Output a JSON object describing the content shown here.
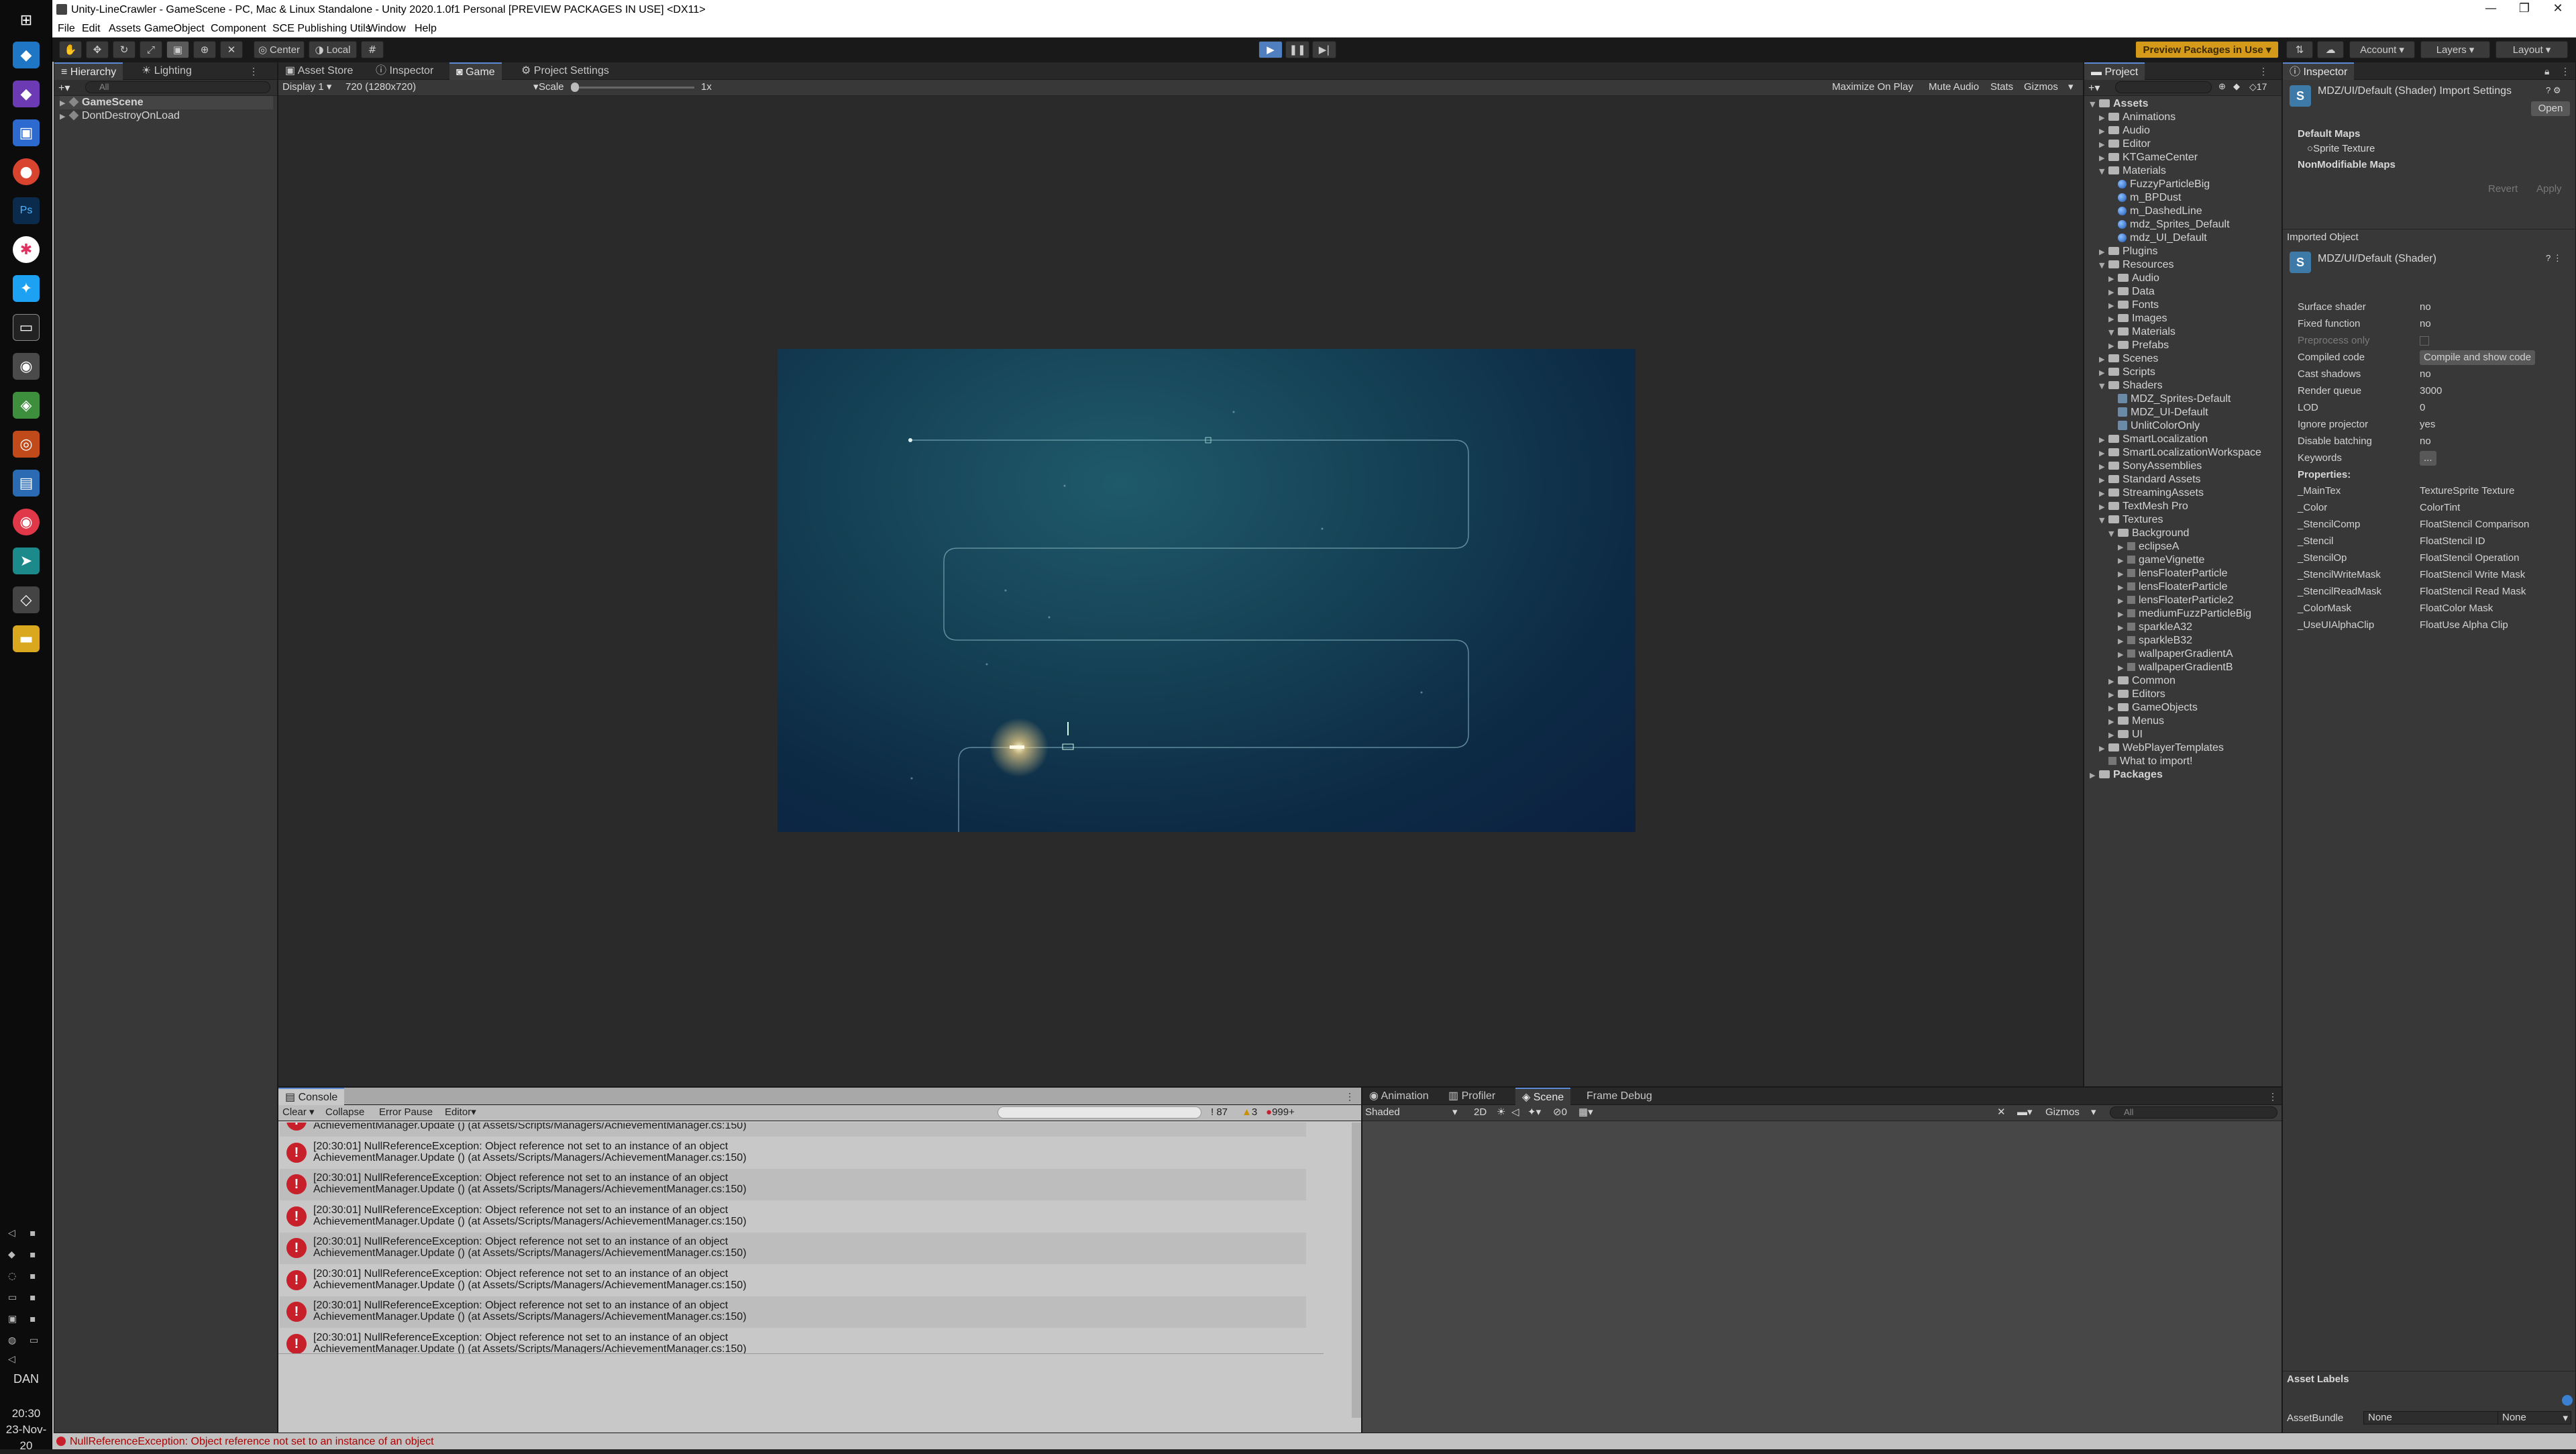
{
  "taskbar": {
    "user": "DAN",
    "time": "20:30",
    "date": "23-Nov-20"
  },
  "window": {
    "title": "Unity-LineCrawler - GameScene - PC, Mac & Linux Standalone - Unity 2020.1.0f1 Personal [PREVIEW PACKAGES IN USE] <DX11>",
    "minimize": "—",
    "restore": "❐",
    "close": "✕"
  },
  "menu": [
    "File",
    "Edit",
    "Assets",
    "GameObject",
    "Component",
    "SCE Publishing Utils",
    "Window",
    "Help"
  ],
  "toolbar": {
    "center": "Center",
    "local": "Local",
    "preview": "Preview Packages in Use ▾",
    "account": "Account",
    "layers": "Layers",
    "layout": "Layout"
  },
  "hierarchy": {
    "tab_hierarchy": "Hierarchy",
    "tab_lighting": "Lighting",
    "search_placeholder": "All",
    "items": [
      "GameScene",
      "DontDestroyOnLoad"
    ]
  },
  "center": {
    "tabs": [
      "Asset Store",
      "Inspector",
      "Game",
      "Project Settings"
    ],
    "display": "Display 1",
    "resolution": "720 (1280x720)",
    "scale_label": "Scale",
    "scale_value": "1x",
    "maximize": "Maximize On Play",
    "mute": "Mute Audio",
    "stats": "Stats",
    "gizmos": "Gizmos"
  },
  "project": {
    "tab": "Project",
    "count": "17",
    "items": [
      {
        "d": 0,
        "t": "Assets",
        "k": "f",
        "b": 1
      },
      {
        "d": 1,
        "t": "Animations",
        "k": "f"
      },
      {
        "d": 1,
        "t": "Audio",
        "k": "f"
      },
      {
        "d": 1,
        "t": "Editor",
        "k": "f"
      },
      {
        "d": 1,
        "t": "KTGameCenter",
        "k": "f"
      },
      {
        "d": 1,
        "t": "Materials",
        "k": "f"
      },
      {
        "d": 2,
        "t": "FuzzyParticleBig",
        "k": "m"
      },
      {
        "d": 2,
        "t": "m_BPDust",
        "k": "m"
      },
      {
        "d": 2,
        "t": "m_DashedLine",
        "k": "m"
      },
      {
        "d": 2,
        "t": "mdz_Sprites_Default",
        "k": "m"
      },
      {
        "d": 2,
        "t": "mdz_UI_Default",
        "k": "m"
      },
      {
        "d": 1,
        "t": "Plugins",
        "k": "f"
      },
      {
        "d": 1,
        "t": "Resources",
        "k": "f"
      },
      {
        "d": 2,
        "t": "Audio",
        "k": "f"
      },
      {
        "d": 2,
        "t": "Data",
        "k": "f"
      },
      {
        "d": 2,
        "t": "Fonts",
        "k": "f"
      },
      {
        "d": 2,
        "t": "Images",
        "k": "f"
      },
      {
        "d": 2,
        "t": "Materials",
        "k": "f"
      },
      {
        "d": 2,
        "t": "Prefabs",
        "k": "f"
      },
      {
        "d": 1,
        "t": "Scenes",
        "k": "f"
      },
      {
        "d": 1,
        "t": "Scripts",
        "k": "f"
      },
      {
        "d": 1,
        "t": "Shaders",
        "k": "f"
      },
      {
        "d": 2,
        "t": "MDZ_Sprites-Default",
        "k": "s"
      },
      {
        "d": 2,
        "t": "MDZ_UI-Default",
        "k": "s"
      },
      {
        "d": 2,
        "t": "UnlitColorOnly",
        "k": "s"
      },
      {
        "d": 1,
        "t": "SmartLocalization",
        "k": "f"
      },
      {
        "d": 1,
        "t": "SmartLocalizationWorkspace",
        "k": "f"
      },
      {
        "d": 1,
        "t": "SonyAssemblies",
        "k": "f"
      },
      {
        "d": 1,
        "t": "Standard Assets",
        "k": "f"
      },
      {
        "d": 1,
        "t": "StreamingAssets",
        "k": "f"
      },
      {
        "d": 1,
        "t": "TextMesh Pro",
        "k": "f"
      },
      {
        "d": 1,
        "t": "Textures",
        "k": "f"
      },
      {
        "d": 2,
        "t": "Background",
        "k": "f"
      },
      {
        "d": 3,
        "t": "eclipseA",
        "k": "t"
      },
      {
        "d": 3,
        "t": "gameVignette",
        "k": "t"
      },
      {
        "d": 3,
        "t": "lensFloaterParticle",
        "k": "t"
      },
      {
        "d": 3,
        "t": "lensFloaterParticle",
        "k": "t"
      },
      {
        "d": 3,
        "t": "lensFloaterParticle2",
        "k": "t"
      },
      {
        "d": 3,
        "t": "mediumFuzzParticleBig",
        "k": "t"
      },
      {
        "d": 3,
        "t": "sparkleA32",
        "k": "t"
      },
      {
        "d": 3,
        "t": "sparkleB32",
        "k": "t"
      },
      {
        "d": 3,
        "t": "wallpaperGradientA",
        "k": "t"
      },
      {
        "d": 3,
        "t": "wallpaperGradientB",
        "k": "t"
      },
      {
        "d": 2,
        "t": "Common",
        "k": "f"
      },
      {
        "d": 2,
        "t": "Editors",
        "k": "f"
      },
      {
        "d": 2,
        "t": "GameObjects",
        "k": "f"
      },
      {
        "d": 2,
        "t": "Menus",
        "k": "f"
      },
      {
        "d": 2,
        "t": "UI",
        "k": "f"
      },
      {
        "d": 1,
        "t": "WebPlayerTemplates",
        "k": "f"
      },
      {
        "d": 1,
        "t": "What to import!",
        "k": "x"
      },
      {
        "d": 0,
        "t": "Packages",
        "k": "f",
        "b": 1
      }
    ]
  },
  "inspector": {
    "tab": "Inspector",
    "title": "MDZ/UI/Default (Shader) Import Settings",
    "open": "Open",
    "default_maps": "Default Maps",
    "sprite_texture": "Sprite Texture",
    "nonmod": "NonModifiable Maps",
    "revert": "Revert",
    "apply": "Apply",
    "imported": "Imported Object",
    "shader_title": "MDZ/UI/Default (Shader)",
    "fields": [
      [
        "Surface shader",
        "no"
      ],
      [
        "Fixed function",
        "no"
      ],
      [
        "Preprocess only",
        ""
      ],
      [
        "Compiled code",
        "Compile and show code"
      ],
      [
        "Cast shadows",
        "no"
      ],
      [
        "Render queue",
        "3000"
      ],
      [
        "LOD",
        "0"
      ],
      [
        "Ignore projector",
        "yes"
      ],
      [
        "Disable batching",
        "no"
      ],
      [
        "Keywords",
        "..."
      ]
    ],
    "properties_label": "Properties:",
    "properties": [
      [
        "_MainTex",
        "TextureSprite Texture"
      ],
      [
        "_Color",
        "ColorTint"
      ],
      [
        "_StencilComp",
        "FloatStencil Comparison"
      ],
      [
        "_Stencil",
        "FloatStencil ID"
      ],
      [
        "_StencilOp",
        "FloatStencil Operation"
      ],
      [
        "_StencilWriteMask",
        "FloatStencil Write Mask"
      ],
      [
        "_StencilReadMask",
        "FloatStencil Read Mask"
      ],
      [
        "_ColorMask",
        "FloatColor Mask"
      ],
      [
        "_UseUIAlphaClip",
        "FloatUse Alpha Clip"
      ]
    ],
    "asset_labels": "Asset Labels",
    "assetbundle": "AssetBundle",
    "none1": "None",
    "none2": "None"
  },
  "console": {
    "tab": "Console",
    "clear": "Clear",
    "collapse": "Collapse",
    "error_pause": "Error Pause",
    "editor": "Editor",
    "count_info": "87",
    "count_warn": "3",
    "count_err": "999+",
    "line1": "[20:30:01] NullReferenceException: Object reference not set to an instance of an object",
    "line2": "AchievementManager.Update () (at Assets/Scripts/Managers/AchievementManager.cs:150)",
    "rows": 8
  },
  "scene": {
    "tabs": [
      "Animation",
      "Profiler",
      "Scene",
      "Frame Debug"
    ],
    "shaded": "Shaded",
    "mode2d": "2D",
    "hidden": "0",
    "gizmos": "Gizmos",
    "search": "All"
  },
  "status": {
    "message": "NullReferenceException: Object reference not set to an instance of an object"
  }
}
